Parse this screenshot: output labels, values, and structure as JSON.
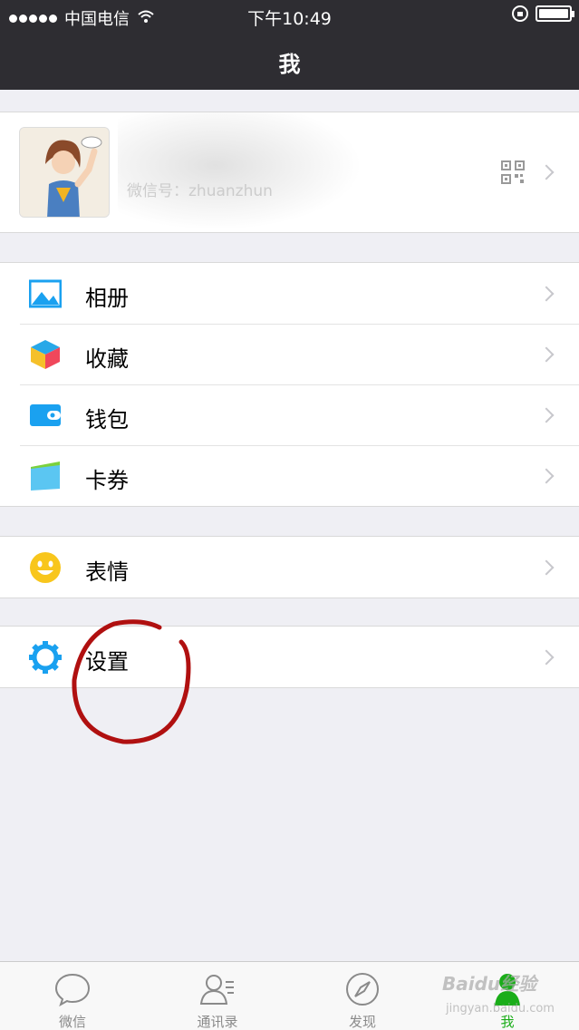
{
  "status_bar": {
    "carrier": "中国电信",
    "time": "下午10:49"
  },
  "nav": {
    "title": "我"
  },
  "profile": {
    "id_text": "微信号：zhuanzhun"
  },
  "groups": [
    [
      {
        "label": "相册",
        "icon": "album-icon"
      },
      {
        "label": "收藏",
        "icon": "favorites-icon"
      },
      {
        "label": "钱包",
        "icon": "wallet-icon"
      },
      {
        "label": "卡券",
        "icon": "card-coupon-icon"
      }
    ],
    [
      {
        "label": "表情",
        "icon": "sticker-smiley-icon"
      }
    ],
    [
      {
        "label": "设置",
        "icon": "settings-gear-icon"
      }
    ]
  ],
  "tabs": [
    {
      "label": "微信",
      "icon": "chat-bubble-icon"
    },
    {
      "label": "通讯录",
      "icon": "contacts-icon"
    },
    {
      "label": "发现",
      "icon": "compass-icon"
    },
    {
      "label": "我",
      "icon": "person-icon",
      "active": true
    }
  ],
  "colors": {
    "nav_bg": "#2e2d32",
    "active_tab": "#1aad19",
    "annotation": "#b01010"
  },
  "watermark": {
    "main": "Baidu经验",
    "sub": "jingyan.baidu.com"
  }
}
